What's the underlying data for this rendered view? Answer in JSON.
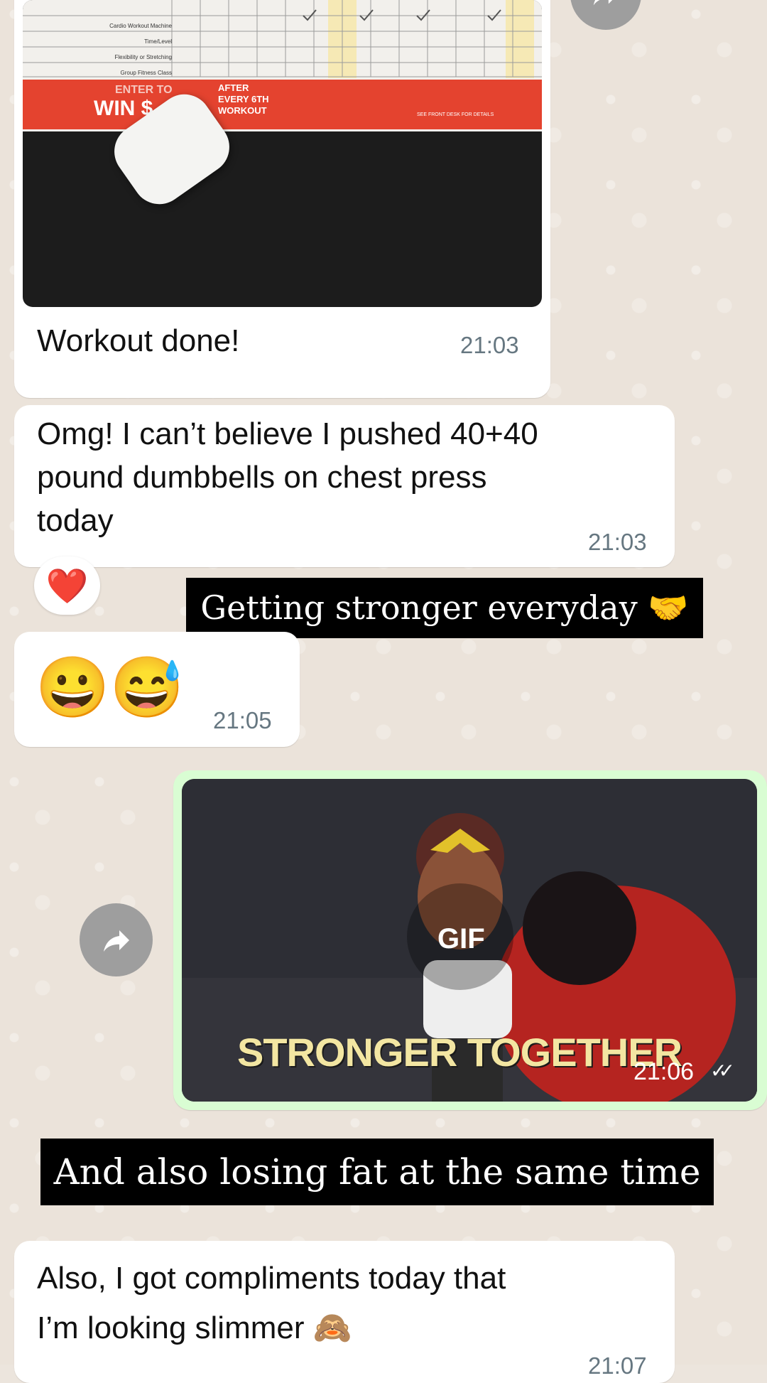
{
  "messages": {
    "m1": {
      "text": "Workout done!",
      "time": "21:03",
      "sheet": {
        "rows": [
          "Cardio Workout Machine",
          "Time/Level",
          "Flexibility or Stretching",
          "Group Fitness Class"
        ],
        "banner_enter": "ENTER TO",
        "banner_win": "WIN $",
        "banner_after": "AFTER",
        "banner_every": "EVERY 6TH",
        "banner_workout": "WORKOUT",
        "banner_desk": "SEE FRONT DESK FOR DETAILS"
      }
    },
    "m2": {
      "line1": "Omg! I can’t believe I pushed 40+40",
      "line2": "pound dumbbells on chest press",
      "line3": "today",
      "time": "21:03",
      "reaction": "❤️"
    },
    "m3": {
      "emoji": "😀😅",
      "time": "21:05"
    },
    "m4": {
      "gif_label": "GIF",
      "gif_text": "STRONGER TOGETHER",
      "time": "21:06",
      "status": "✓✓"
    },
    "m5": {
      "line1": "Also, I got compliments today that",
      "line2": "I’m looking slimmer 🙈",
      "time": "21:07"
    }
  },
  "captions": {
    "c1": "Getting stronger everyday 🤝",
    "c2": "And also losing fat at the same time"
  },
  "colors": {
    "wallpaper": "#ebe3da",
    "incoming_bubble": "#ffffff",
    "outgoing_bubble": "#d9fdd3",
    "timestamp": "#667781",
    "read_ticks": "#53bdeb",
    "caption_bg": "#000000"
  },
  "icons": {
    "forward": "forward-arrow-icon",
    "read_receipt": "double-check-icon",
    "reaction": "heart-reaction"
  }
}
